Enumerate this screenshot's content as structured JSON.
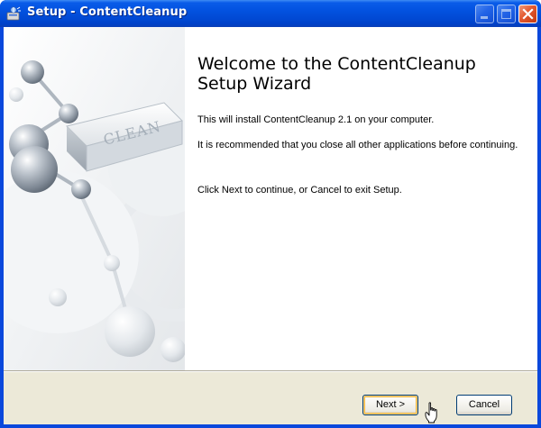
{
  "window": {
    "title": "Setup - ContentCleanup",
    "icon": "setup-installer-icon",
    "controls": {
      "minimize": "minimize-icon",
      "maximize": "maximize-icon",
      "close": "close-icon"
    }
  },
  "side_image": {
    "description_icon": "clean-eraser-logo",
    "logo_text": "CLEAN"
  },
  "content": {
    "heading": "Welcome to the ContentCleanup Setup Wizard",
    "paragraphs": [
      "This will install ContentCleanup 2.1 on your computer.",
      "It is recommended that you close all other applications before continuing.",
      "Click Next to continue, or Cancel to exit Setup."
    ]
  },
  "buttons": {
    "next": "Next >",
    "cancel": "Cancel"
  },
  "colors": {
    "titlebar": "#0353e1",
    "dialog_bg": "#ece9d8",
    "close_button": "#e3582e",
    "default_button_focus": "#f2b640"
  }
}
